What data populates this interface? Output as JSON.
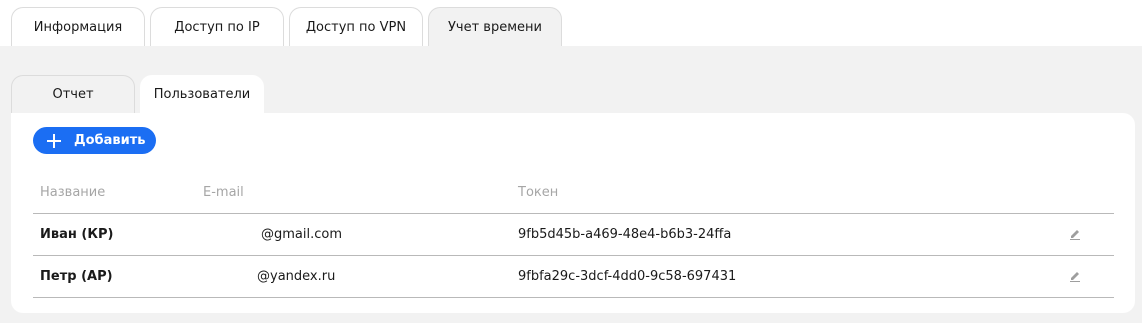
{
  "top_tabs": [
    {
      "label": "Информация"
    },
    {
      "label": "Доступ по IP"
    },
    {
      "label": "Доступ по VPN"
    },
    {
      "label": "Учет времени"
    }
  ],
  "sub_tabs": [
    {
      "label": "Отчет"
    },
    {
      "label": "Пользователи"
    }
  ],
  "toolbar": {
    "add_label": "Добавить"
  },
  "table": {
    "headers": {
      "name": "Название",
      "email": "E-mail",
      "token": "Токен"
    },
    "rows": [
      {
        "name": "Иван (КР)",
        "email": "@gmail.com",
        "token": "9fb5d45b-a469-48e4-b6b3-24ffa"
      },
      {
        "name": "Петр (АР)",
        "email": "@yandex.ru",
        "token": "9fbfa29c-3dcf-4dd0-9c58-697431"
      }
    ]
  },
  "colors": {
    "accent": "#1b6ef3",
    "page_bg": "#f2f2f2",
    "panel_bg": "#ffffff",
    "divider": "#b9b9b9"
  },
  "icons": {
    "add": "plus-icon",
    "row_action": "pencil-icon"
  }
}
